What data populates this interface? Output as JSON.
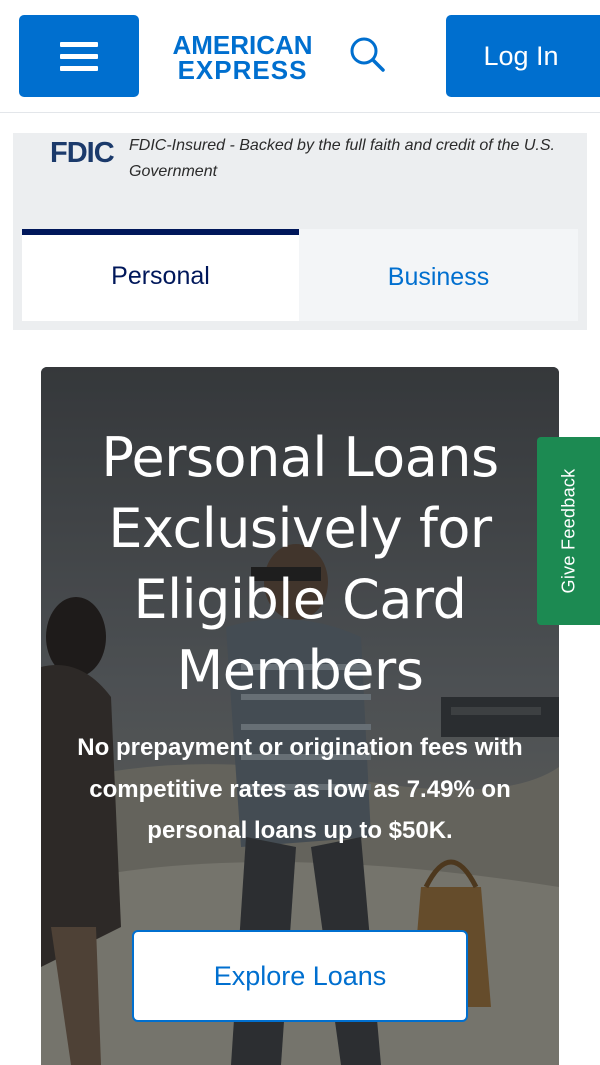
{
  "header": {
    "logo_line1": "AMERICAN",
    "logo_line2": "EXPRESS",
    "login_label": "Log In",
    "icons": {
      "menu": "hamburger-menu-icon",
      "search": "search-icon"
    }
  },
  "fdic": {
    "logo_text": "FDIC",
    "description": "FDIC-Insured - Backed by the full faith and credit of the U.S. Government"
  },
  "tabs": [
    {
      "label": "Personal",
      "selected": true
    },
    {
      "label": "Business",
      "selected": false
    }
  ],
  "hero": {
    "title": "Personal Loans Exclusively for Eligible Card Members",
    "subtitle": "No prepayment or origination fees with competitive rates as low as 7.49% on personal loans up to $50K.",
    "cta_label": "Explore Loans"
  },
  "feedback": {
    "label": "Give Feedback"
  },
  "colors": {
    "brand_blue": "#006fcf",
    "navy": "#00175a",
    "feedback_green": "#1c8a52",
    "panel_gray": "#eceef0"
  }
}
